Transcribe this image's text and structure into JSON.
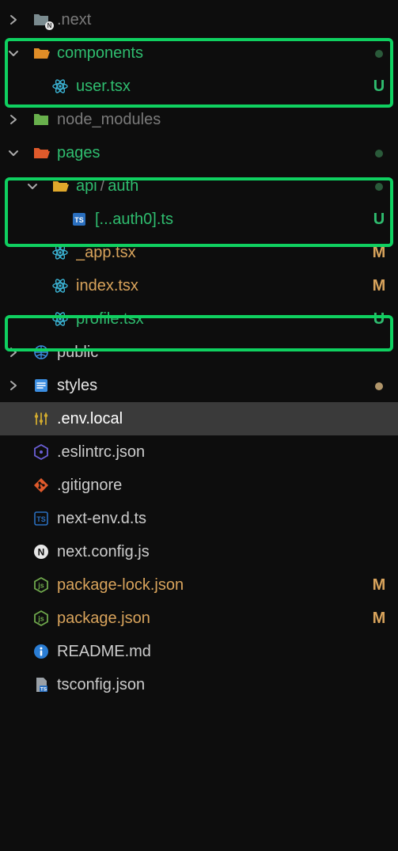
{
  "colors": {
    "green": "#2fbd6f",
    "greenBright": "#0fd060",
    "orange": "#d98b27",
    "orangeLight": "#d9a45c",
    "folderOrange": "#e08d27",
    "folderTeal": "#1f8f6f",
    "folderGreen": "#68b04c",
    "blue": "#3b8de0",
    "react": "#3bb5d6",
    "muted": "#7a7a7a",
    "white": "#e6e6e6",
    "redOrange": "#e05a2b",
    "jsYellow": "#cfa92f",
    "infoBlue": "#2a7dd4",
    "tsBlue": "#2a6fbf",
    "dotTan": "#b0956a"
  },
  "tree": {
    "next": {
      "label": ".next"
    },
    "components": {
      "label": "components",
      "status_dot": true
    },
    "userTsx": {
      "label": "user.tsx",
      "status": "U"
    },
    "nodeModules": {
      "label": "node_modules"
    },
    "pages": {
      "label": "pages",
      "status_dot": true
    },
    "apiAuth": {
      "parts": [
        "api",
        "/",
        "auth"
      ],
      "status_dot": true
    },
    "auth0": {
      "label": "[...auth0].ts",
      "status": "U"
    },
    "appTsx": {
      "label": "_app.tsx",
      "status": "M"
    },
    "indexTsx": {
      "label": "index.tsx",
      "status": "M"
    },
    "profileTsx": {
      "label": "profile.tsx",
      "status": "U"
    },
    "public": {
      "label": "public"
    },
    "styles": {
      "label": "styles",
      "status_dot": true
    },
    "envLocal": {
      "label": ".env.local"
    },
    "eslintrc": {
      "label": ".eslintrc.json"
    },
    "gitignore": {
      "label": ".gitignore"
    },
    "nextEnv": {
      "label": "next-env.d.ts"
    },
    "nextConfig": {
      "label": "next.config.js"
    },
    "pkgLock": {
      "label": "package-lock.json",
      "status": "M"
    },
    "pkg": {
      "label": "package.json",
      "status": "M"
    },
    "readme": {
      "label": "README.md"
    },
    "tsconfig": {
      "label": "tsconfig.json"
    }
  }
}
